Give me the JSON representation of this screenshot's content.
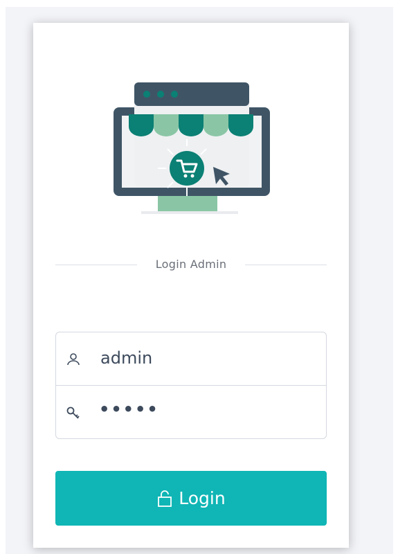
{
  "login": {
    "heading": "Login Admin",
    "username": {
      "value": "admin",
      "icon": "user-icon"
    },
    "password": {
      "masked_value": "•••••",
      "icon": "key-icon"
    },
    "submit_label": "Login",
    "submit_icon": "unlock-icon"
  },
  "colors": {
    "accent": "#10b5b5",
    "illustration_dark": "#3f5566",
    "illustration_teal": "#0b8074",
    "illustration_mint": "#8ac6a5"
  }
}
